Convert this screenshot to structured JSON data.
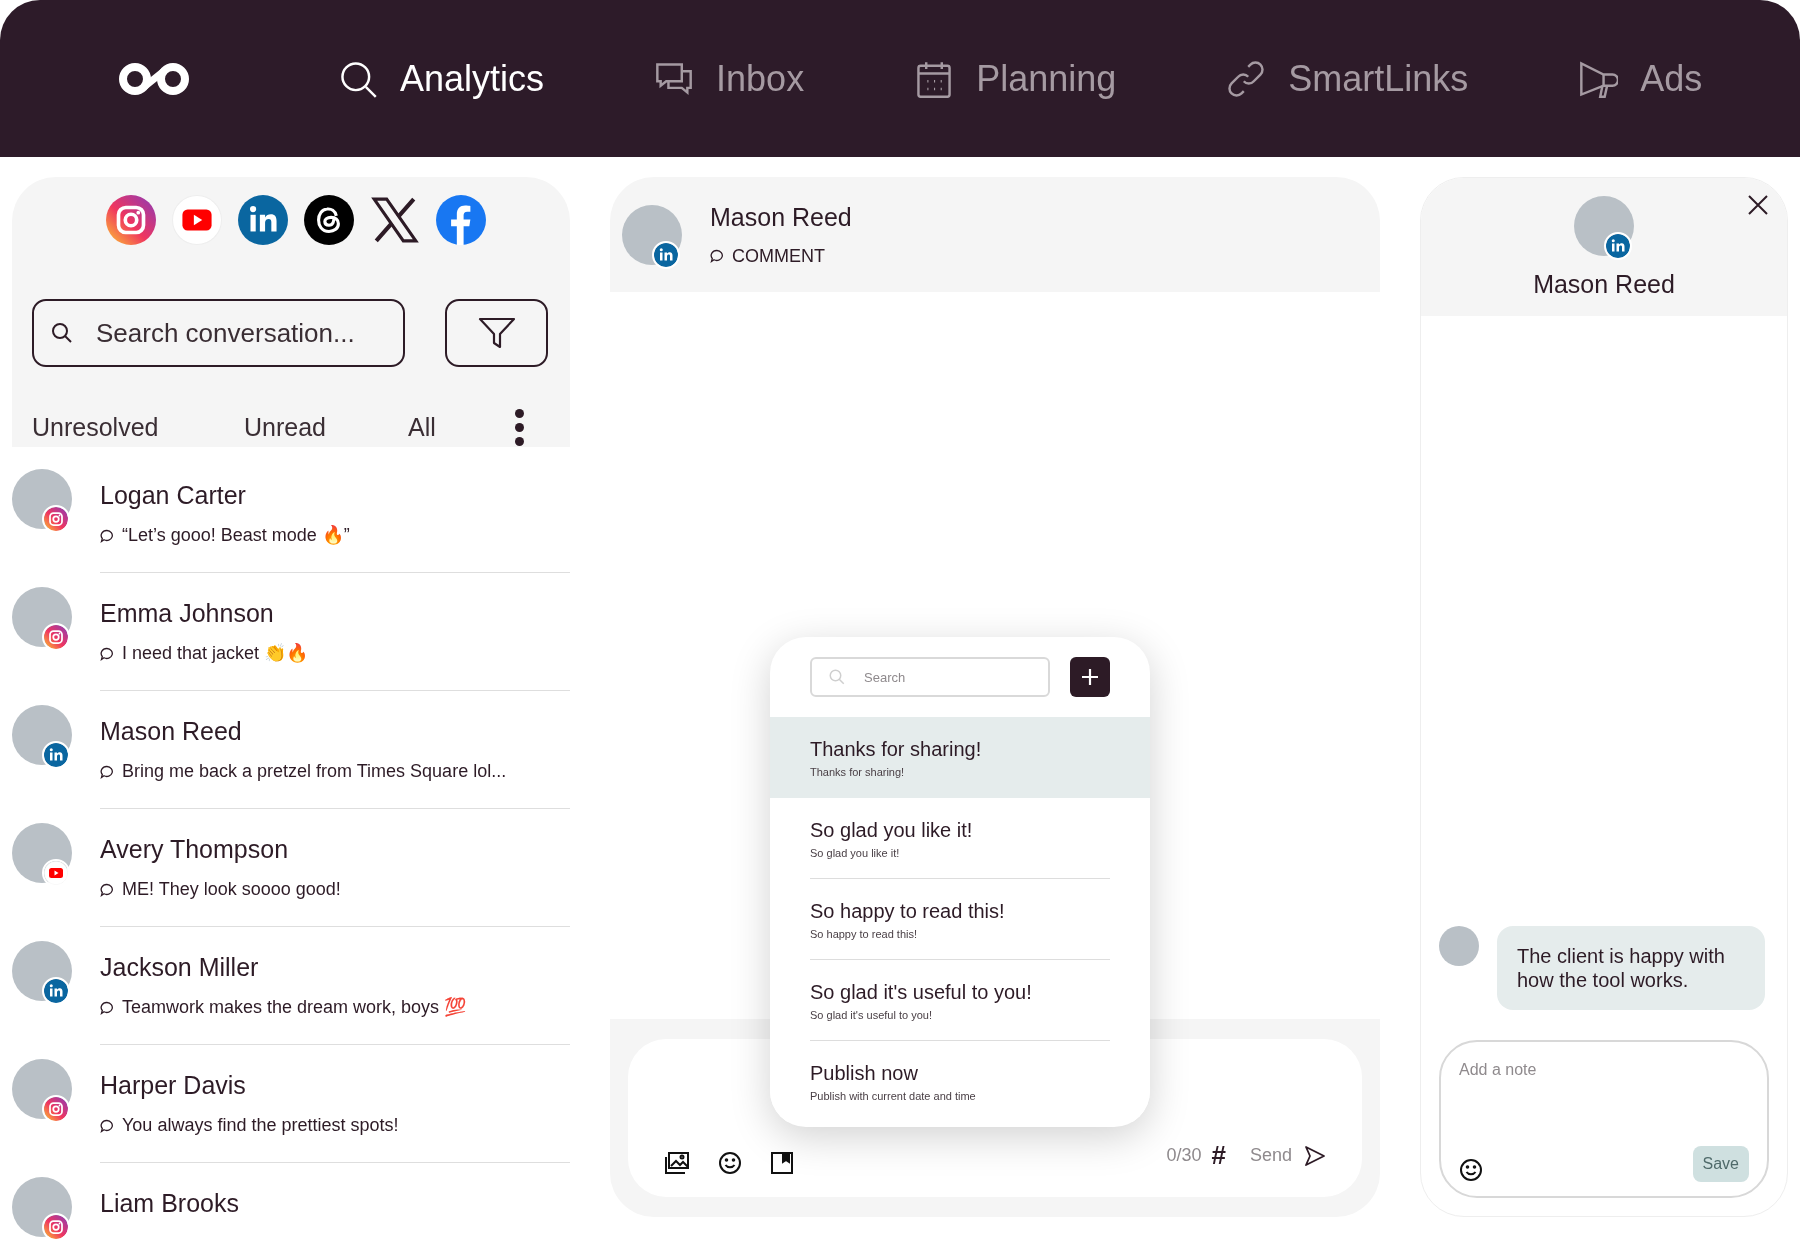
{
  "nav": {
    "items": [
      {
        "label": "Analytics",
        "kind": "search",
        "selected": true
      },
      {
        "label": "Inbox",
        "kind": "chat",
        "selected": false
      },
      {
        "label": "Planning",
        "kind": "calendar",
        "selected": false
      },
      {
        "label": "SmartLinks",
        "kind": "link",
        "selected": false
      },
      {
        "label": "Ads",
        "kind": "megaphone",
        "selected": false
      }
    ]
  },
  "platforms": [
    {
      "kind": "instagram"
    },
    {
      "kind": "youtube"
    },
    {
      "kind": "linkedin"
    },
    {
      "kind": "threads"
    },
    {
      "kind": "x"
    },
    {
      "kind": "facebook"
    }
  ],
  "search": {
    "placeholder": "Search conversation..."
  },
  "filter_tabs": [
    {
      "label": "Unresolved"
    },
    {
      "label": "Unread"
    },
    {
      "label": "All"
    }
  ],
  "conversations": [
    {
      "name": "Logan Carter",
      "preview": "“Let’s gooo! Beast mode 🔥”",
      "badge": {
        "kind": "instagram"
      }
    },
    {
      "name": "Emma Johnson",
      "preview": "I need that jacket 👏🔥",
      "badge": {
        "kind": "instagram"
      }
    },
    {
      "name": "Mason Reed",
      "preview": "Bring me back a pretzel from Times Square lol...",
      "badge": {
        "kind": "linkedin"
      }
    },
    {
      "name": "Avery Thompson",
      "preview": "ME! They look soooo good!",
      "badge": {
        "kind": "youtube"
      }
    },
    {
      "name": "Jackson Miller",
      "preview": "Teamwork makes the dream work, boys 💯",
      "badge": {
        "kind": "linkedin"
      }
    },
    {
      "name": "Harper Davis",
      "preview": "You always find the prettiest spots!",
      "badge": {
        "kind": "instagram"
      }
    },
    {
      "name": "Liam Brooks",
      "badge": {
        "kind": "instagram"
      }
    }
  ],
  "thread": {
    "name": "Mason Reed",
    "badge": {
      "kind": "linkedin"
    },
    "type": "COMMENT"
  },
  "quick_replies": {
    "search_placeholder": "Search",
    "items": [
      {
        "title": "Thanks for sharing!",
        "subtitle": "Thanks for sharing!",
        "selected": true
      },
      {
        "title": "So glad you like it!",
        "subtitle": "So glad you like it!",
        "selected": false
      },
      {
        "title": "So happy to read this!",
        "subtitle": "So happy to read this!",
        "selected": false
      },
      {
        "title": "So glad it's useful to you!",
        "subtitle": "So glad it's useful to you!",
        "selected": false
      },
      {
        "title": "Publish now",
        "subtitle": "Publish with current date and time",
        "selected": false
      }
    ]
  },
  "composer": {
    "counter": "0/30",
    "hashtag": "#",
    "send": "Send"
  },
  "contact_panel": {
    "name": "Mason Reed",
    "badge": {
      "kind": "linkedin"
    },
    "notes": [
      {
        "text": "The client is happy with how the tool works."
      }
    ],
    "note_placeholder": "Add a note",
    "save": "Save"
  }
}
